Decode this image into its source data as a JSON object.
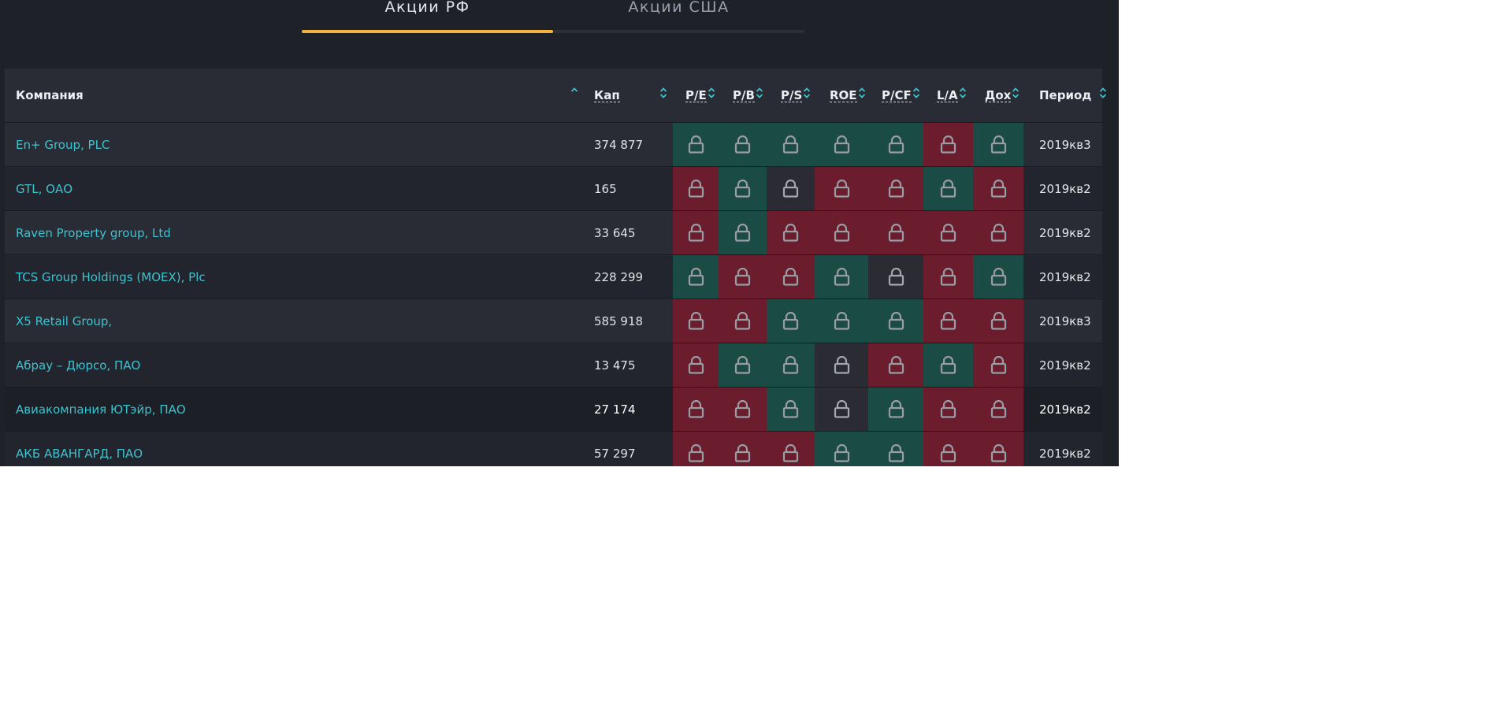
{
  "tabs": [
    {
      "label": "Акции РФ",
      "active": true
    },
    {
      "label": "Акции США",
      "active": false
    }
  ],
  "header": {
    "company": "Компания",
    "cap": "Кап",
    "metrics": [
      "P/E",
      "P/B",
      "P/S",
      "ROE",
      "P/CF",
      "L/A",
      "Дох"
    ],
    "period": "Период"
  },
  "colors": {
    "accent": "#f2b23e",
    "link": "#3cc3cf",
    "good": "#1a4c45",
    "bad": "#6b1d2e",
    "neutral": "#2a2b33"
  },
  "rows": [
    {
      "company": "En+ Group, PLC",
      "cap": "374 877",
      "period": "2019кв3",
      "metrics": [
        "good",
        "good",
        "good",
        "good",
        "good",
        "bad",
        "good"
      ]
    },
    {
      "company": "GTL, ОАО",
      "cap": "165",
      "period": "2019кв2",
      "metrics": [
        "bad",
        "good",
        "neutral",
        "bad",
        "bad",
        "good",
        "bad"
      ]
    },
    {
      "company": "Raven Property group, Ltd",
      "cap": "33 645",
      "period": "2019кв2",
      "metrics": [
        "bad",
        "good",
        "bad",
        "bad",
        "bad",
        "bad",
        "bad"
      ]
    },
    {
      "company": "TCS Group Holdings (MOEX), Plc",
      "cap": "228 299",
      "period": "2019кв2",
      "metrics": [
        "good",
        "bad",
        "bad",
        "good",
        "neutral",
        "bad",
        "good"
      ]
    },
    {
      "company": "X5 Retail Group,",
      "cap": "585 918",
      "period": "2019кв3",
      "metrics": [
        "bad",
        "bad",
        "good",
        "good",
        "good",
        "bad",
        "bad"
      ]
    },
    {
      "company": "Абрау – Дюрсо, ПАО",
      "cap": "13 475",
      "period": "2019кв2",
      "metrics": [
        "bad",
        "good",
        "good",
        "neutral",
        "bad",
        "good",
        "bad"
      ]
    },
    {
      "company": "Авиакомпания ЮТэйр, ПАО",
      "cap": "27 174",
      "period": "2019кв2",
      "metrics": [
        "bad",
        "bad",
        "good",
        "neutral",
        "good",
        "bad",
        "bad"
      ]
    },
    {
      "company": "АКБ АВАНГАРД, ПАО",
      "cap": "57 297",
      "period": "2019кв2",
      "metrics": [
        "bad",
        "bad",
        "bad",
        "good",
        "good",
        "bad",
        "bad"
      ]
    }
  ]
}
